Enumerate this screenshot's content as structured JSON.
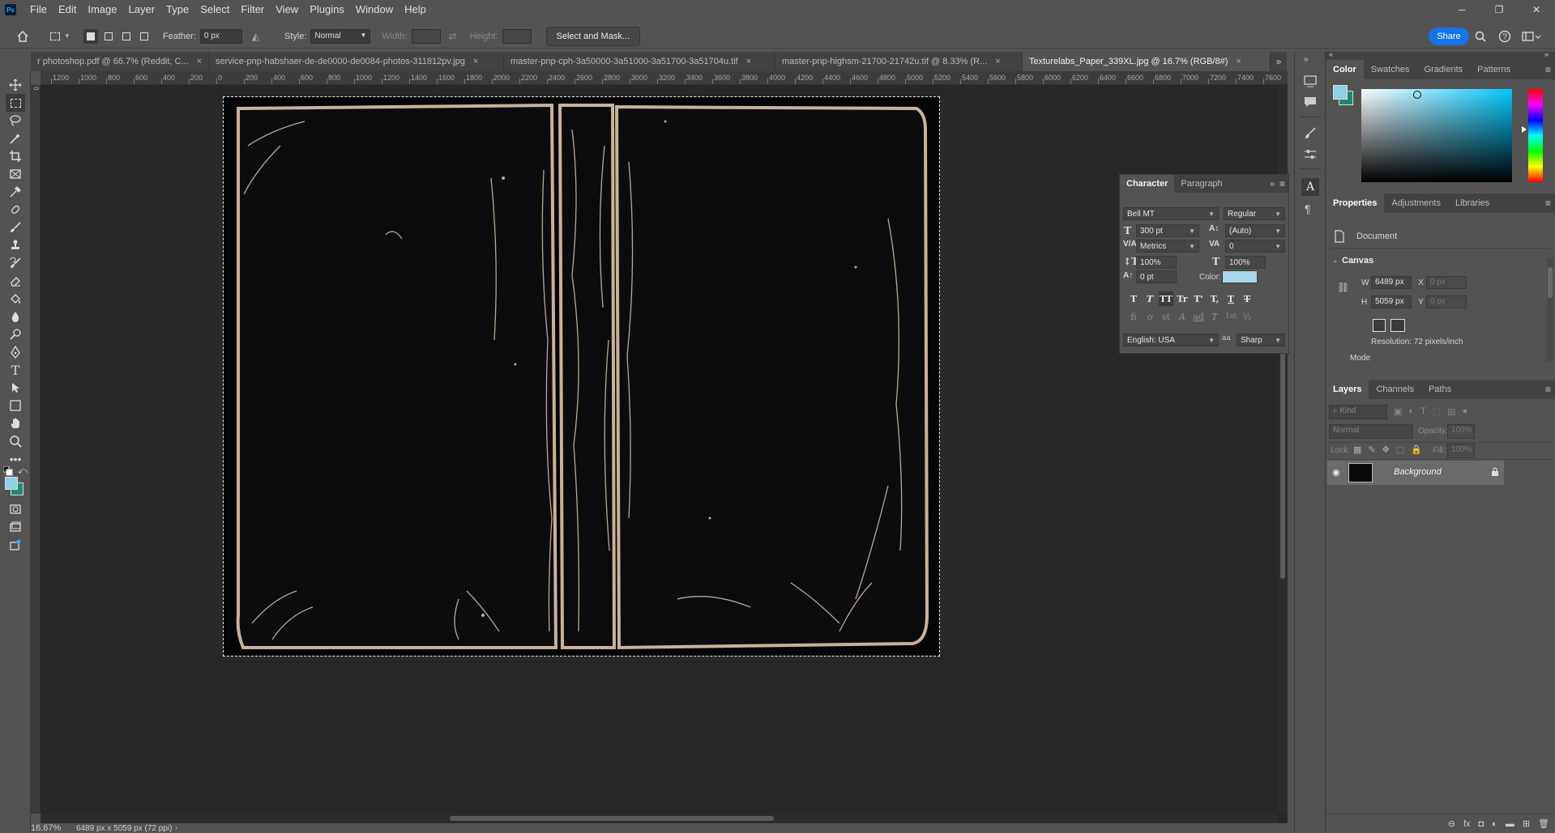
{
  "app": {
    "logo": "Ps"
  },
  "menu": [
    "File",
    "Edit",
    "Image",
    "Layer",
    "Type",
    "Select",
    "Filter",
    "View",
    "Plugins",
    "Window",
    "Help"
  ],
  "window_controls": {
    "minimize": "─",
    "maximize": "❐",
    "close": "✕"
  },
  "options": {
    "feather_label": "Feather:",
    "feather_value": "0 px",
    "style_label": "Style:",
    "style_value": "Normal",
    "width_label": "Width:",
    "height_label": "Height:",
    "select_mask": "Select and Mask...",
    "share": "Share"
  },
  "tabs": [
    {
      "label": "r photoshop.pdf @ 66.7% (Reddit, C...",
      "close": "×"
    },
    {
      "label": "service-pnp-habshaer-de-de0000-de0084-photos-311812pv.jpg",
      "close": "×"
    },
    {
      "label": "master-pnp-cph-3a50000-3a51000-3a51700-3a51704u.tif",
      "close": "×"
    },
    {
      "label": "master-pnp-highsm-21700-21742u.tif @ 8.33% (R...",
      "close": "×"
    },
    {
      "label": "Texturelabs_Paper_339XL.jpg @ 16.7% (RGB/8#)",
      "close": "×"
    }
  ],
  "ruler_h": [
    "1200",
    "1000",
    "800",
    "600",
    "400",
    "200",
    "0",
    "200",
    "400",
    "600",
    "800",
    "1000",
    "1200",
    "1400",
    "1600",
    "1800",
    "2000",
    "2200",
    "2400",
    "2600",
    "2800",
    "3000",
    "3200",
    "3400",
    "3600",
    "3800",
    "4000",
    "4200",
    "4400",
    "4600",
    "4800",
    "5000",
    "5200",
    "5400",
    "5600",
    "5800",
    "6000",
    "6200",
    "6400",
    "6600",
    "6800",
    "7000",
    "7200",
    "7400",
    "7600"
  ],
  "status": {
    "zoom": "16.67%",
    "doc_info": "6489 px x 5059 px (72 ppi)"
  },
  "character": {
    "tabs": [
      "Character",
      "Paragraph"
    ],
    "font_family": "Bell MT",
    "font_style": "Regular",
    "size": "300 pt",
    "leading": "(Auto)",
    "kerning": "Metrics",
    "tracking": "0",
    "vscale": "100%",
    "hscale": "100%",
    "baseline": "0 pt",
    "color_label": "Color:",
    "color": "#a8d8ea",
    "language": "English: USA",
    "antialias_label": "aa",
    "antialias": "Sharp",
    "styles": [
      "T",
      "T",
      "TT",
      "Tr",
      "T'",
      "T,",
      "T",
      "T"
    ],
    "opentype": [
      "fi",
      "ơ",
      "st",
      "A",
      "ad",
      "T",
      "1st",
      "½"
    ]
  },
  "color_panel": {
    "tabs": [
      "Color",
      "Swatches",
      "Gradients",
      "Patterns"
    ],
    "fg": "#8fd0e8",
    "bg": "#1e8a6a"
  },
  "properties": {
    "tabs": [
      "Properties",
      "Adjustments",
      "Libraries"
    ],
    "document_label": "Document",
    "canvas_label": "Canvas",
    "w_label": "W",
    "w_value": "6489 px",
    "h_label": "H",
    "h_value": "5059 px",
    "x_label": "X",
    "x_placeholder": "0 px",
    "y_label": "Y",
    "y_placeholder": "0 px",
    "resolution": "Resolution: 72 pixels/inch",
    "mode_label": "Mode"
  },
  "layers": {
    "tabs": [
      "Layers",
      "Channels",
      "Paths"
    ],
    "kind_placeholder": "Kind",
    "blend_mode": "Normal",
    "opacity_label": "Opacity:",
    "opacity": "100%",
    "lock_label": "Lock:",
    "fill_label": "Fill:",
    "fill": "100%",
    "items": [
      {
        "name": "Background",
        "visible": true,
        "locked": true
      }
    ]
  }
}
